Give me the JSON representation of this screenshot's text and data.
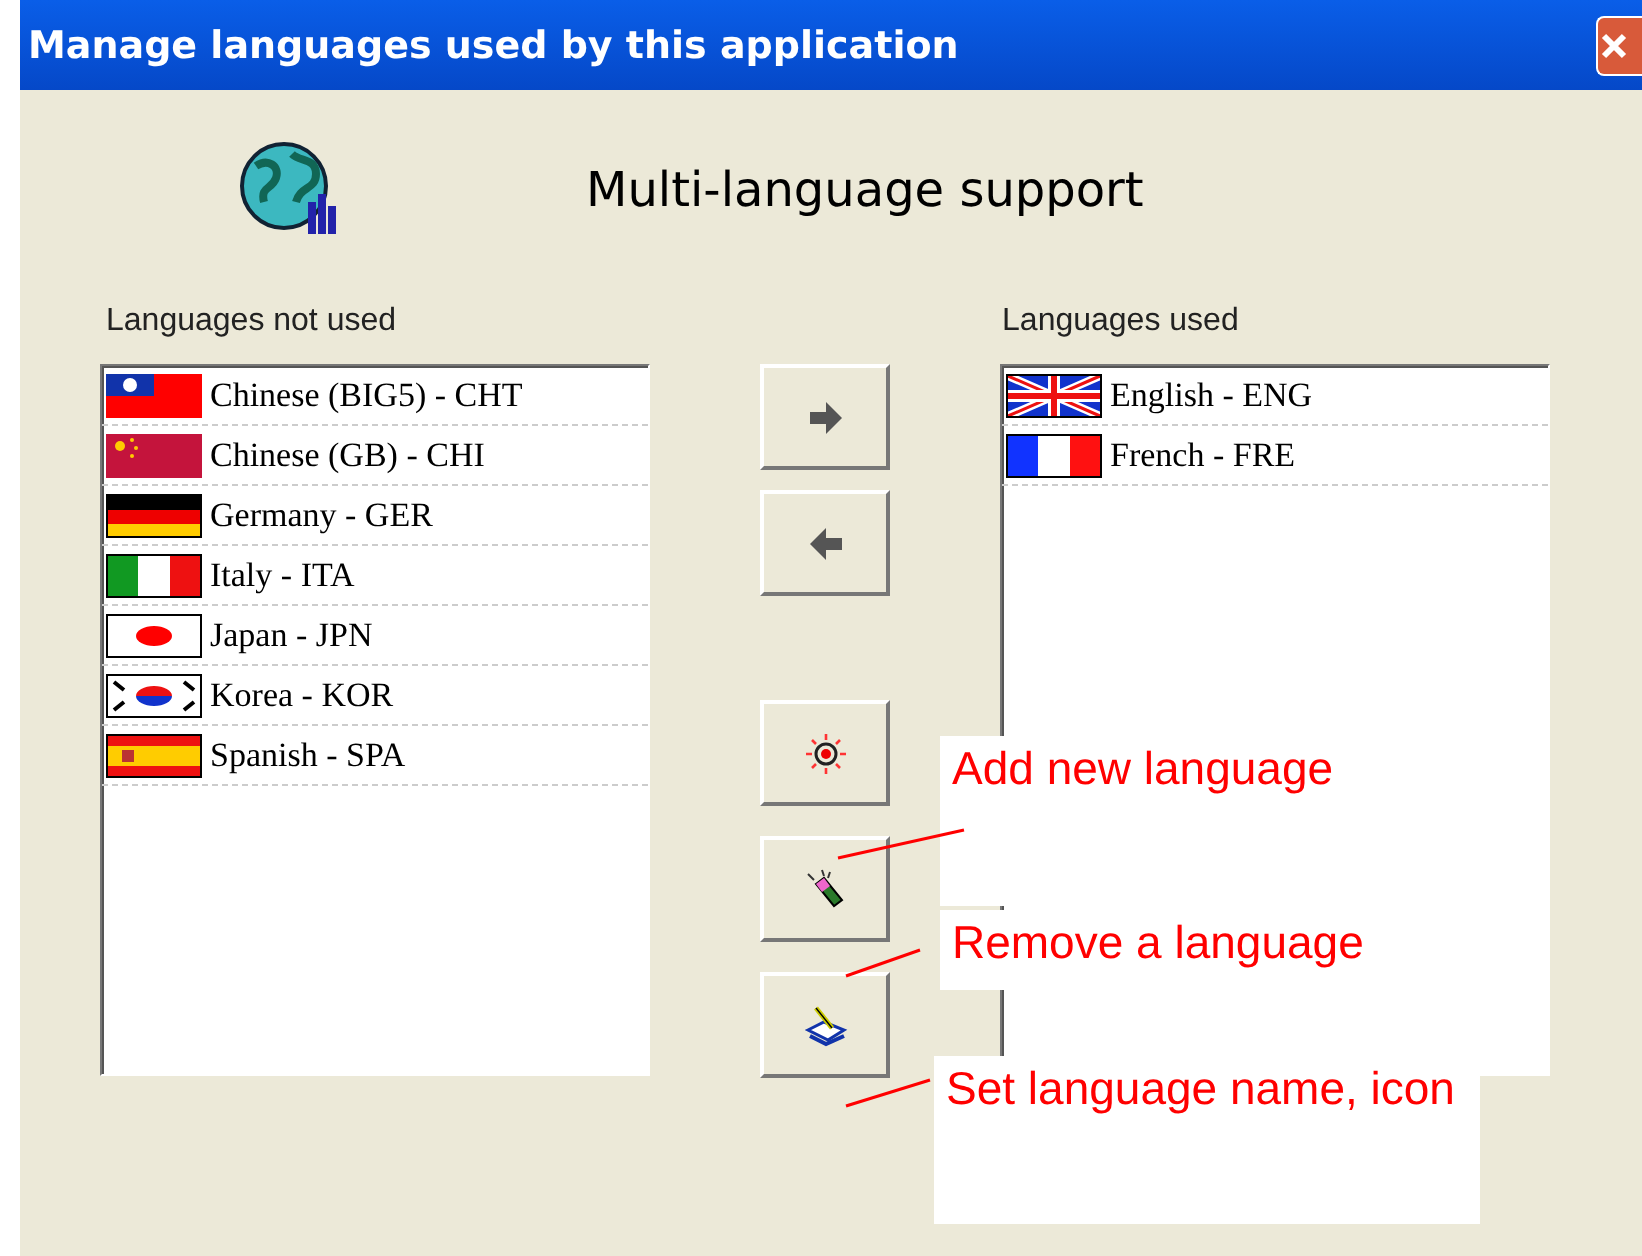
{
  "window": {
    "title": "Manage languages used by this application"
  },
  "heading": "Multi-language support",
  "lists": [
    {
      "label": "Languages not used",
      "items": [
        {
          "name": "Chinese (BIG5) - CHT",
          "kind": "taiwan"
        },
        {
          "name": "Chinese (GB) - CHI",
          "kind": "china"
        },
        {
          "name": "Germany - GER",
          "kind": "germany"
        },
        {
          "name": "Italy - ITA",
          "kind": "italy"
        },
        {
          "name": "Japan - JPN",
          "kind": "japan"
        },
        {
          "name": "Korea - KOR",
          "kind": "korea"
        },
        {
          "name": "Spanish - SPA",
          "kind": "spain"
        }
      ]
    },
    {
      "label": "Languages used",
      "items": [
        {
          "name": "English - ENG",
          "kind": "uk"
        },
        {
          "name": "French - FRE",
          "kind": "france"
        }
      ]
    }
  ],
  "buttons": [
    {
      "kind": "move-right"
    },
    {
      "kind": "move-left"
    },
    {
      "kind": "add"
    },
    {
      "kind": "remove"
    },
    {
      "kind": "edit"
    }
  ],
  "annotations": [
    {
      "text": "Add new language"
    },
    {
      "text": "Remove a language"
    },
    {
      "text": "Set language name, icon"
    }
  ]
}
